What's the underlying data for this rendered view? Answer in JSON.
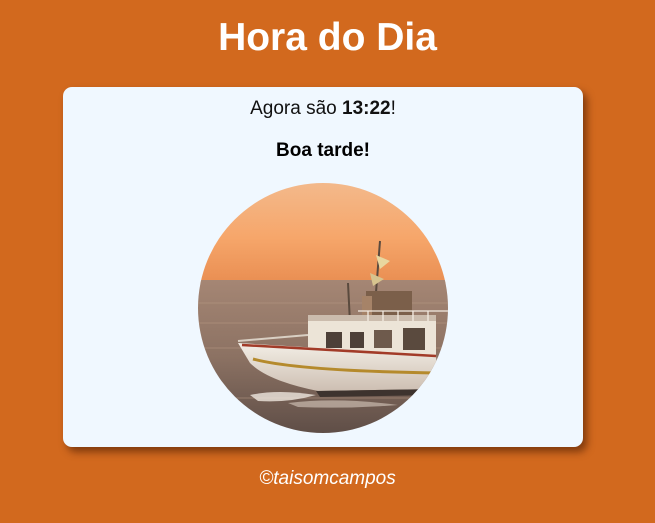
{
  "header": {
    "title": "Hora do Dia"
  },
  "card": {
    "time_prefix": "Agora são ",
    "time_value": "13:22",
    "time_suffix": "!",
    "greeting": "Boa tarde!",
    "image_subject": "fishing-boat-at-sunset"
  },
  "footer": {
    "credit": "©taisomcampos"
  },
  "colors": {
    "background": "#d2691e",
    "card": "#f0f8ff",
    "title_text": "#ffffff"
  }
}
